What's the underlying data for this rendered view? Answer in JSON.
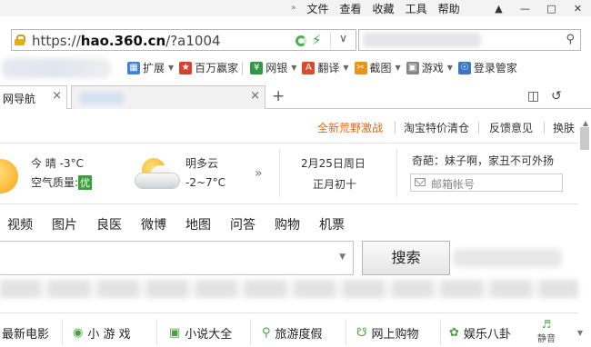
{
  "menu": {
    "chevron": "»",
    "items": [
      "文件",
      "查看",
      "收藏",
      "工具",
      "帮助"
    ],
    "window_controls": [
      "shirt-icon",
      "minimize-icon",
      "maximize-icon",
      "close-icon"
    ]
  },
  "address": {
    "protocol": "https://",
    "host": "hao.360.cn",
    "path": "/?a1004"
  },
  "extensions": [
    {
      "label": "扩展",
      "icon": "grid-icon",
      "color": "#3f82d8"
    },
    {
      "label": "百万赢家",
      "icon": "trophy-icon",
      "color": "#d8402f"
    },
    {
      "label": "网银",
      "icon": "bank-icon",
      "color": "#2e9a46"
    },
    {
      "label": "翻译",
      "icon": "translate-icon",
      "color": "#d84b2f"
    },
    {
      "label": "截图",
      "icon": "scissors-icon",
      "color": "#e89419"
    },
    {
      "label": "游戏",
      "icon": "gamepad-icon",
      "color": "#888888"
    },
    {
      "label": "登录管家",
      "icon": "login-icon",
      "color": "#3a76c4"
    }
  ],
  "tabs": {
    "active_label": "网导航",
    "close_glyph": "×",
    "new_tab": "+"
  },
  "toplinks": [
    "全新荒野激战",
    "淘宝特价清仓",
    "反馈意见",
    "换肤"
  ],
  "weather": {
    "today_label": "今  晴  -3°C",
    "aqi_label": "空气质量:",
    "aqi_value": "优",
    "tomorrow_cond": "明多云",
    "tomorrow_temp": "-2~7°C",
    "more": "»"
  },
  "date": {
    "gregorian": "2月25日周日",
    "lunar": "正月初十"
  },
  "quote": "奇葩：妹子啊，家丑不可外扬",
  "mail_placeholder": "邮箱帐号",
  "search_categories": [
    "视频",
    "图片",
    "良医",
    "微博",
    "地图",
    "问答",
    "购物",
    "机票"
  ],
  "search_button": "搜索",
  "bottom_nav": [
    {
      "label": "最新电影",
      "icon": ""
    },
    {
      "label": "小 游 戏",
      "icon": "game-icon"
    },
    {
      "label": "小说大全",
      "icon": "book-icon"
    },
    {
      "label": "旅游度假",
      "icon": "location-icon"
    },
    {
      "label": "网上购物",
      "icon": "cart-icon"
    },
    {
      "label": "娱乐八卦",
      "icon": "entertainment-icon"
    }
  ],
  "mute_label": "静音"
}
